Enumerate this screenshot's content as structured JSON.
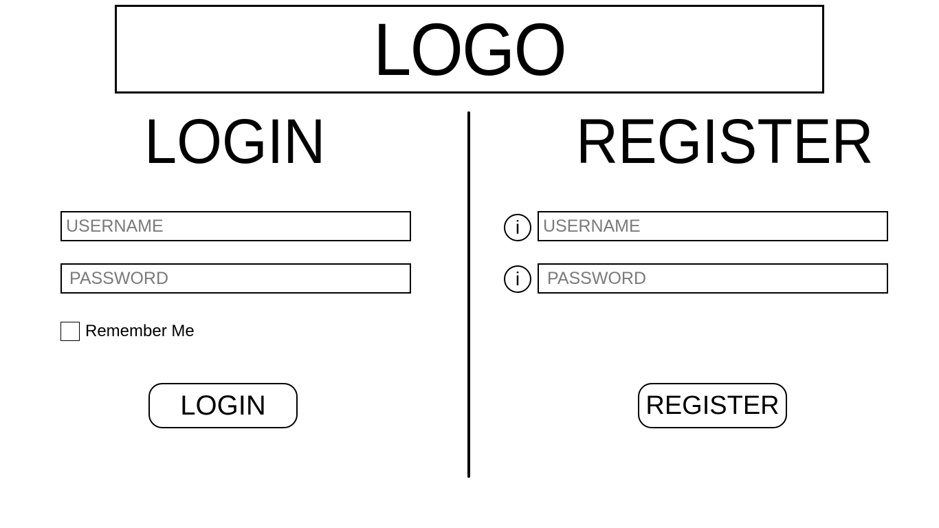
{
  "logo": {
    "text": "LOGO"
  },
  "login": {
    "title": "LOGIN",
    "username_placeholder": "USERNAME",
    "password_placeholder": "PASSWORD",
    "remember_label": "Remember Me",
    "remember_checked": false,
    "button_label": "LOGIN"
  },
  "register": {
    "title": "REGISTER",
    "username_placeholder": "USERNAME",
    "password_placeholder": "PASSWORD",
    "info_glyph": "i",
    "button_label": "REGISTER"
  },
  "icons": {
    "info": "info-icon",
    "checkbox": "checkbox-unchecked"
  },
  "colors": {
    "text": "#000000",
    "placeholder": "#7a7a7a",
    "background": "#ffffff"
  }
}
